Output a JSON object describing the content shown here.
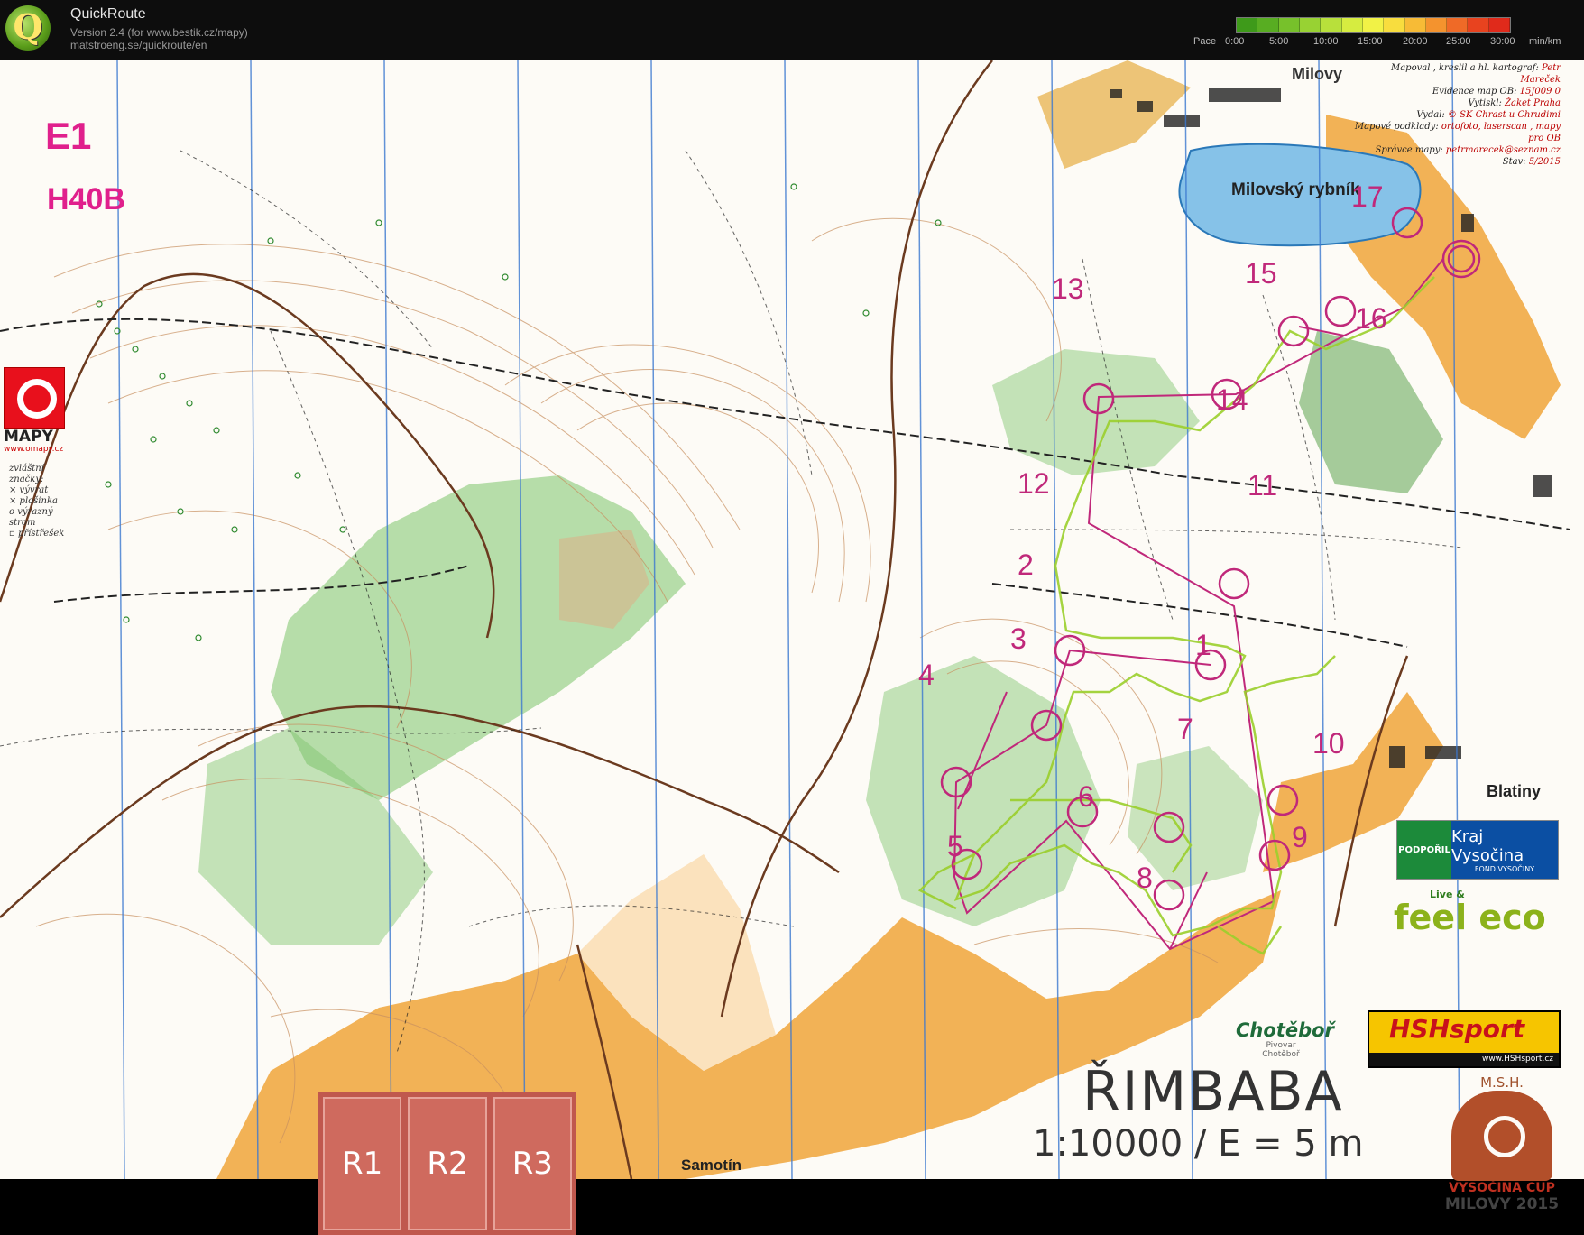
{
  "app": {
    "title": "QuickRoute",
    "version": "Version 2.4  (for www.bestik.cz/mapy)",
    "url": "matstroeng.se/quickroute/en",
    "logo_letter": "Q"
  },
  "pace_scale": {
    "label": "Pace",
    "unit": "min/km",
    "ticks": [
      "0:00",
      "5:00",
      "10:00",
      "15:00",
      "20:00",
      "25:00",
      "30:00"
    ],
    "colors": [
      "#3e9a1a",
      "#58ad22",
      "#77c12b",
      "#98d233",
      "#b8e03b",
      "#d6ec40",
      "#f1f246",
      "#f8dd3e",
      "#f7bb36",
      "#f4932e",
      "#ef6a27",
      "#e8431f",
      "#e02a1b"
    ]
  },
  "map": {
    "event_code": "E1",
    "course_code": "H40B",
    "map_name": "ŘIMBABA",
    "scale": "1:10000 / E = 5 m",
    "lake": "Milovský rybník",
    "towns": {
      "milovy": "Milovy",
      "blatiny": "Blatiny",
      "samotin": "Samotín"
    },
    "credits": [
      {
        "k": "Mapoval , kreslil a hl. kartograf:",
        "v": "Petr Mareček"
      },
      {
        "k": "Evidence map OB:",
        "v": "15J009 0"
      },
      {
        "k": "Vytiskl:",
        "v": "Žaket Praha"
      },
      {
        "k": "Vydal:",
        "v": "© SK Chrast u Chrudimi"
      },
      {
        "k": "Mapové podklady:",
        "v": "ortofoto, laserscan , mapy pro OB"
      },
      {
        "k": "Správce mapy:",
        "v": "petrmarecek@seznam.cz"
      },
      {
        "k": "Stav:",
        "v": "5/2015"
      }
    ],
    "legend": [
      "zvláštní značky:",
      "× vývrat",
      "× plošinka",
      "o výrazný strom",
      "▫ přístřešek"
    ],
    "mapy_logo": {
      "text": "MAPY",
      "url": "www.omapy.cz"
    },
    "controls": [
      "1",
      "2",
      "3",
      "4",
      "5",
      "6",
      "7",
      "8",
      "9",
      "10",
      "11",
      "12",
      "13",
      "14",
      "15",
      "16",
      "17"
    ],
    "colors": {
      "course": "#c0287a",
      "route": "#9bcf2c",
      "forest": "#7cc46a",
      "open": "#f0a43a",
      "water": "#86c2e8",
      "road": "#6b3a1f"
    }
  },
  "sponsors": {
    "vysocina": {
      "left": "PODPOŘIL",
      "name": "Kraj Vysočina",
      "sub": "FOND VYSOČINY"
    },
    "feeleco": {
      "small": "Live &",
      "big": "feel eco"
    },
    "hsh": {
      "name": "HSHsport",
      "url": "www.HSHsport.cz"
    },
    "chotebor": {
      "name": "Chotěboř",
      "sub1": "Pivovar",
      "sub2": "Chotěboř"
    },
    "msh": {
      "top": "M.S.H.",
      "cup": "VYSOČINA CUP",
      "year": "MILOVY 2015"
    }
  },
  "rounds": [
    "R1",
    "R2",
    "R3"
  ]
}
